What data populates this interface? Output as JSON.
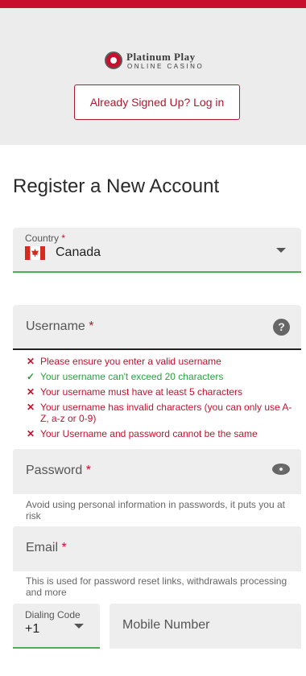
{
  "brand": {
    "line1": "Platinum Play",
    "line2": "ONLINE CASINO",
    "accent": "#c8102e"
  },
  "header": {
    "login_label": "Already Signed Up? Log in"
  },
  "form": {
    "title": "Register a New Account",
    "country": {
      "label": "Country",
      "required": "*",
      "value": "Canada",
      "flag_icon": "canada-flag-icon"
    },
    "username": {
      "placeholder": "Username",
      "required": "*",
      "help_icon": "question-icon"
    },
    "username_rules": [
      {
        "status": "error",
        "text": "Please ensure you enter a valid username"
      },
      {
        "status": "ok",
        "text": "Your username can't exceed 20 characters"
      },
      {
        "status": "error",
        "text": "Your username must have at least 5 characters"
      },
      {
        "status": "error",
        "text": "Your username has invalid characters (you can only use A-Z, a-z or 0-9)"
      },
      {
        "status": "error",
        "text": "Your Username and password cannot be the same"
      }
    ],
    "password": {
      "placeholder": "Password",
      "required": "*",
      "hint": "Avoid using personal information in passwords, it puts you at risk"
    },
    "email": {
      "placeholder": "Email",
      "required": "*",
      "hint": "This is used for password reset links, withdrawals processing and more"
    },
    "dialing": {
      "label": "Dialing Code",
      "value": "+1"
    },
    "mobile": {
      "placeholder": "Mobile Number"
    }
  },
  "icons": {
    "error": "✕",
    "ok": "✓"
  },
  "colors": {
    "error": "#c8102e",
    "ok": "#2e9e40",
    "valid_underline": "#4caf50"
  }
}
